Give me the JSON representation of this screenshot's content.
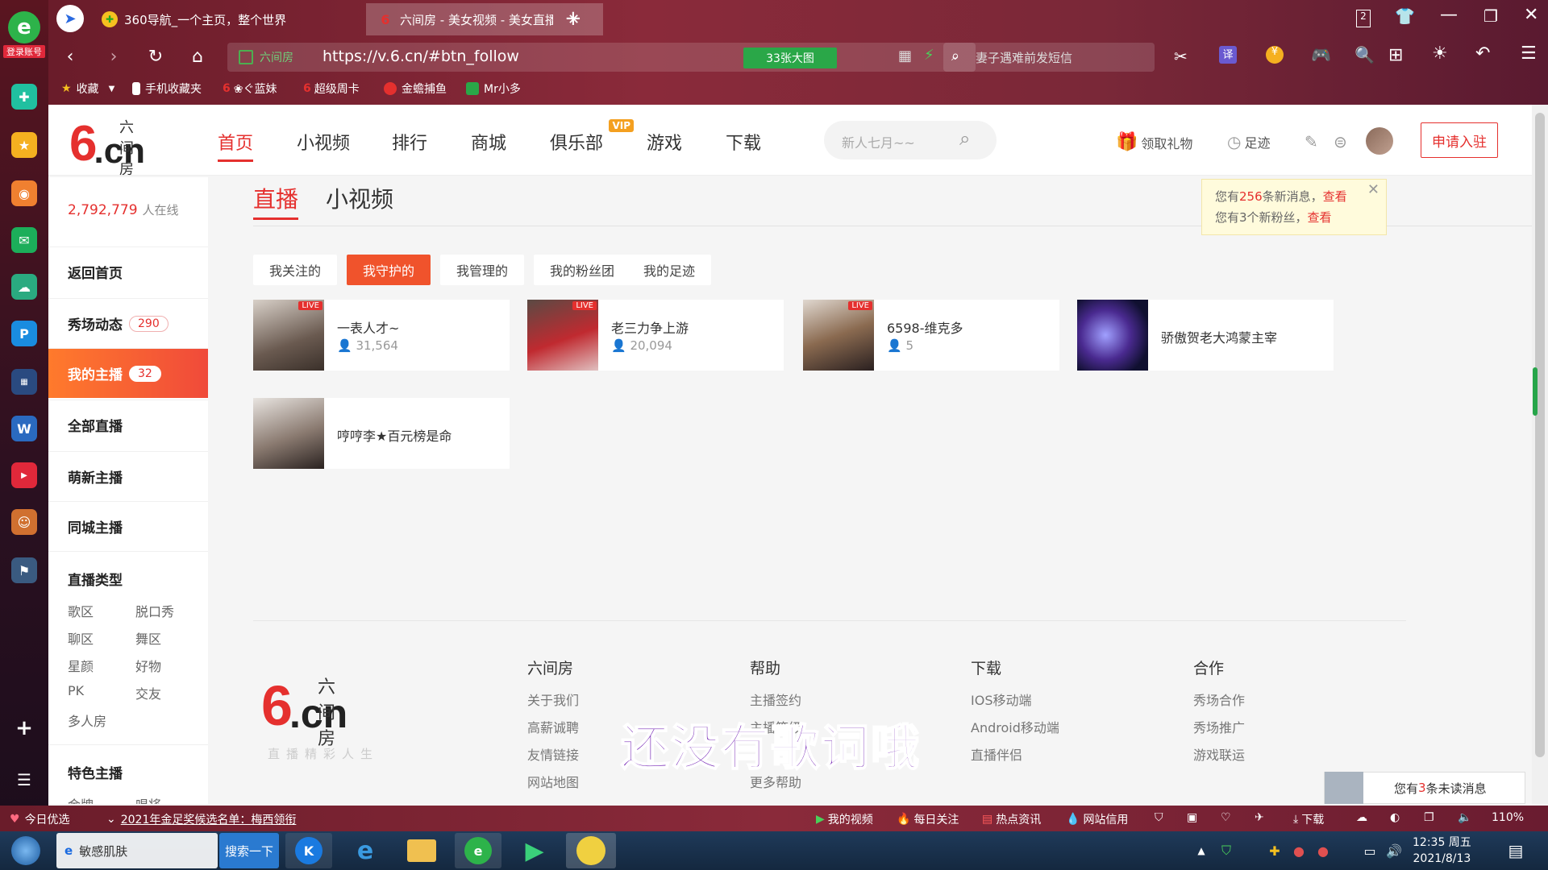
{
  "leftbar": {
    "logo_tag": "登录账号"
  },
  "tabs": [
    {
      "title": "360导航_一个主页，整个世界"
    },
    {
      "title": "六间房 - 美女视频 - 美女直播"
    }
  ],
  "tab_counter": "2",
  "address": {
    "site": "六间房",
    "url": "https://v.6.cn/#btn_follow",
    "bigpic": "33张大图"
  },
  "browser_search": {
    "placeholder": "妻子遇难前发短信"
  },
  "translate_label": "译",
  "bookmarks": [
    "收藏",
    "手机收藏夹",
    "❀ぐ蓝妹",
    "超级周卡",
    "金蟾捕鱼",
    "Mr小多"
  ],
  "site": {
    "logo_text": "六间房",
    "nav": [
      {
        "label": "首页"
      },
      {
        "label": "小视频"
      },
      {
        "label": "排行"
      },
      {
        "label": "商城"
      },
      {
        "label": "俱乐部"
      },
      {
        "label": "游戏"
      },
      {
        "label": "下载"
      }
    ],
    "vip": "VIP",
    "search_placeholder": "新人七月~~",
    "gift": "领取礼物",
    "history": "足迹",
    "apply": "申请入驻"
  },
  "sidebar": {
    "online_count": "2,792,779",
    "online_label": "人在线",
    "items": [
      {
        "label": "返回首页",
        "badge": ""
      },
      {
        "label": "秀场动态",
        "badge": "290"
      },
      {
        "label": "我的主播",
        "badge": "32"
      },
      {
        "label": "全部直播",
        "badge": ""
      },
      {
        "label": "萌新主播",
        "badge": ""
      },
      {
        "label": "同城主播",
        "badge": ""
      }
    ],
    "category_title": "直播类型",
    "categories": [
      "歌区",
      "脱口秀",
      "聊区",
      "舞区",
      "星颜",
      "好物",
      "PK",
      "交友",
      "多人房"
    ],
    "featured_title": "特色主播",
    "featured": [
      "金牌",
      "唱将"
    ]
  },
  "main": {
    "tabs": [
      "直播",
      "小视频"
    ],
    "subtabs": [
      "我关注的",
      "我守护的",
      "我管理的",
      "我的粉丝团",
      "我的足迹"
    ],
    "cards": [
      {
        "name": "一表人才~",
        "fans": "31,564",
        "live": "LIVE"
      },
      {
        "name": "老三力争上游",
        "fans": "20,094",
        "live": "LIVE"
      },
      {
        "name": "6598-维克多",
        "fans": "5",
        "live": "LIVE"
      },
      {
        "name": "骄傲贺老大鸿蒙主宰",
        "fans": "",
        "live": ""
      },
      {
        "name": "哼哼李★百元榜是命",
        "fans": "",
        "live": ""
      }
    ]
  },
  "notice": {
    "line1_pre": "您有",
    "line1_num": "256",
    "line1_mid": "条新消息，",
    "line1_link": "查看",
    "line2_pre": "您有3个新粉丝，",
    "line2_link": "查看"
  },
  "footer": {
    "logo_text": "六间房",
    "slogan": "直播精彩人生",
    "cols": [
      {
        "title": "六间房",
        "links": [
          "关于我们",
          "高薪诚聘",
          "友情链接",
          "网站地图"
        ]
      },
      {
        "title": "帮助",
        "links": [
          "主播签约",
          "主播等级",
          "",
          "更多帮助"
        ]
      },
      {
        "title": "下载",
        "links": [
          "IOS移动端",
          "Android移动端",
          "直播伴侣"
        ]
      },
      {
        "title": "合作",
        "links": [
          "秀场合作",
          "秀场推广",
          "游戏联运"
        ]
      }
    ]
  },
  "lyric": "还没有歌词哦",
  "unread": {
    "pre": "您有",
    "num": "3",
    "post": "条未读消息"
  },
  "statusbar": {
    "left1": "今日优选",
    "news": "2021年金足奖候选名单：梅西领衔",
    "items": [
      "我的视频",
      "每日关注",
      "热点资讯",
      "网站信用"
    ],
    "download": "下载",
    "zoom": "110%"
  },
  "taskbar": {
    "search_item": "敏感肌肤",
    "search_btn": "搜索一下",
    "time": "12:35 周五",
    "date": "2021/8/13"
  },
  "colors": {
    "accent": "#e5302e",
    "active_gradient_start": "#ff7a2c"
  }
}
